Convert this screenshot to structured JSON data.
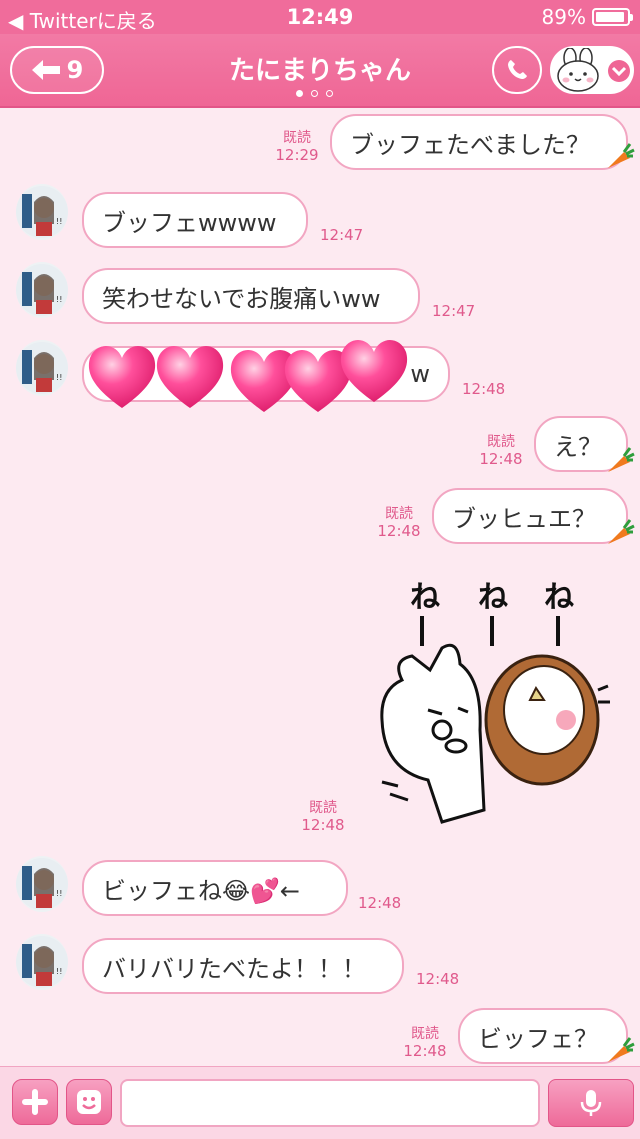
{
  "status_bar": {
    "back_label": "◀ Twitterに戻る",
    "time": "12:49",
    "battery": "89%"
  },
  "header": {
    "back_count": "9",
    "title": "たにまりちゃん",
    "page_dots": 3,
    "active_dot": 0
  },
  "messages": [
    {
      "side": "right",
      "text": "ブッフェたべました？",
      "read": "既読",
      "time": "12:29"
    },
    {
      "side": "left",
      "text": "ブッフェwwww",
      "time": "12:47"
    },
    {
      "side": "left",
      "text": "笑わせないでお腹痛いww",
      "time": "12:47"
    },
    {
      "side": "left",
      "text": "w",
      "time": "12:48",
      "covered_by_hearts": 5
    },
    {
      "side": "right",
      "text": "え？",
      "read": "既読",
      "time": "12:48"
    },
    {
      "side": "right",
      "text": "ブッヒュエ？",
      "read": "既読",
      "time": "12:48"
    },
    {
      "side": "right",
      "type": "sticker",
      "sticker_text": [
        "ね",
        "ね",
        "ね"
      ],
      "read": "既読",
      "time": "12:48"
    },
    {
      "side": "left",
      "text": "ビッフェね😂💕←",
      "time": "12:48"
    },
    {
      "side": "left",
      "text": "バリバリたべたよ！！！",
      "time": "12:48"
    },
    {
      "side": "right",
      "text": "ビッフェ？",
      "read": "既読",
      "time": "12:48"
    }
  ],
  "colors": {
    "pink": "#f06c9b",
    "background": "#fdeaf1",
    "bubble_border": "#f2a6c2",
    "read_text": "#e05a8c"
  }
}
